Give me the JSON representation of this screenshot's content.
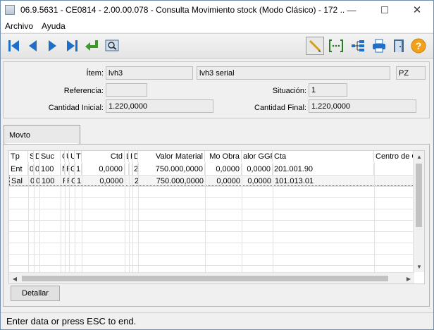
{
  "window": {
    "title": "06.9.5631 - CE0814 - 2.00.00.078 - Consulta Movimiento stock (Modo Clásico) - 172 ..."
  },
  "menu": [
    "Archivo",
    "Ayuda"
  ],
  "toolbar_icons": [
    "first-record-icon",
    "prev-record-icon",
    "next-record-icon",
    "last-record-icon",
    "return-icon",
    "preview-icon",
    "edit-pencil-icon",
    "range-select-icon",
    "tree-view-icon",
    "print-icon",
    "exit-door-icon",
    "help-icon"
  ],
  "header": {
    "item_label": "Ítem:",
    "item_code": "lvh3",
    "item_desc": "lvh3 serial",
    "unit": "PZ",
    "ref_label": "Referencia:",
    "ref_value": "",
    "situation_label": "Situación:",
    "situation_value": "1",
    "qty_initial_label": "Cantidad Inicial:",
    "qty_initial_value": "1.220,0000",
    "qty_final_label": "Cantidad Final:",
    "qty_final_value": "1.220,0000"
  },
  "tab": {
    "label": "Movto"
  },
  "grid": {
    "columns": [
      "Tp",
      "S",
      "D",
      "Suc",
      "C",
      "U",
      "U",
      "Ti",
      "Ctd",
      "L",
      "R",
      "D",
      "Valor Material",
      "Mo Obra",
      "alor GGF",
      "Cta",
      "Centro de C"
    ],
    "rows": [
      [
        "Ent",
        "0",
        "0",
        "100",
        "N",
        "F",
        "G",
        "1",
        "0,0000",
        "",
        "",
        "2",
        "750.000,0000",
        "0,0000",
        "0,0000",
        "201.001.90",
        ""
      ],
      [
        "Sal",
        "0",
        "0",
        "100",
        "P",
        "R",
        "G",
        "1",
        "0,0000",
        "",
        "",
        "2",
        "750.000,0000",
        "0,0000",
        "0,0000",
        "101.013.01",
        ""
      ]
    ]
  },
  "detail_button": "Detallar",
  "status": "Enter data or press ESC to end.",
  "colors": {
    "accent_blue": "#1f6fc9",
    "return_green": "#3a9a2a",
    "help_orange": "#f3a11a"
  }
}
